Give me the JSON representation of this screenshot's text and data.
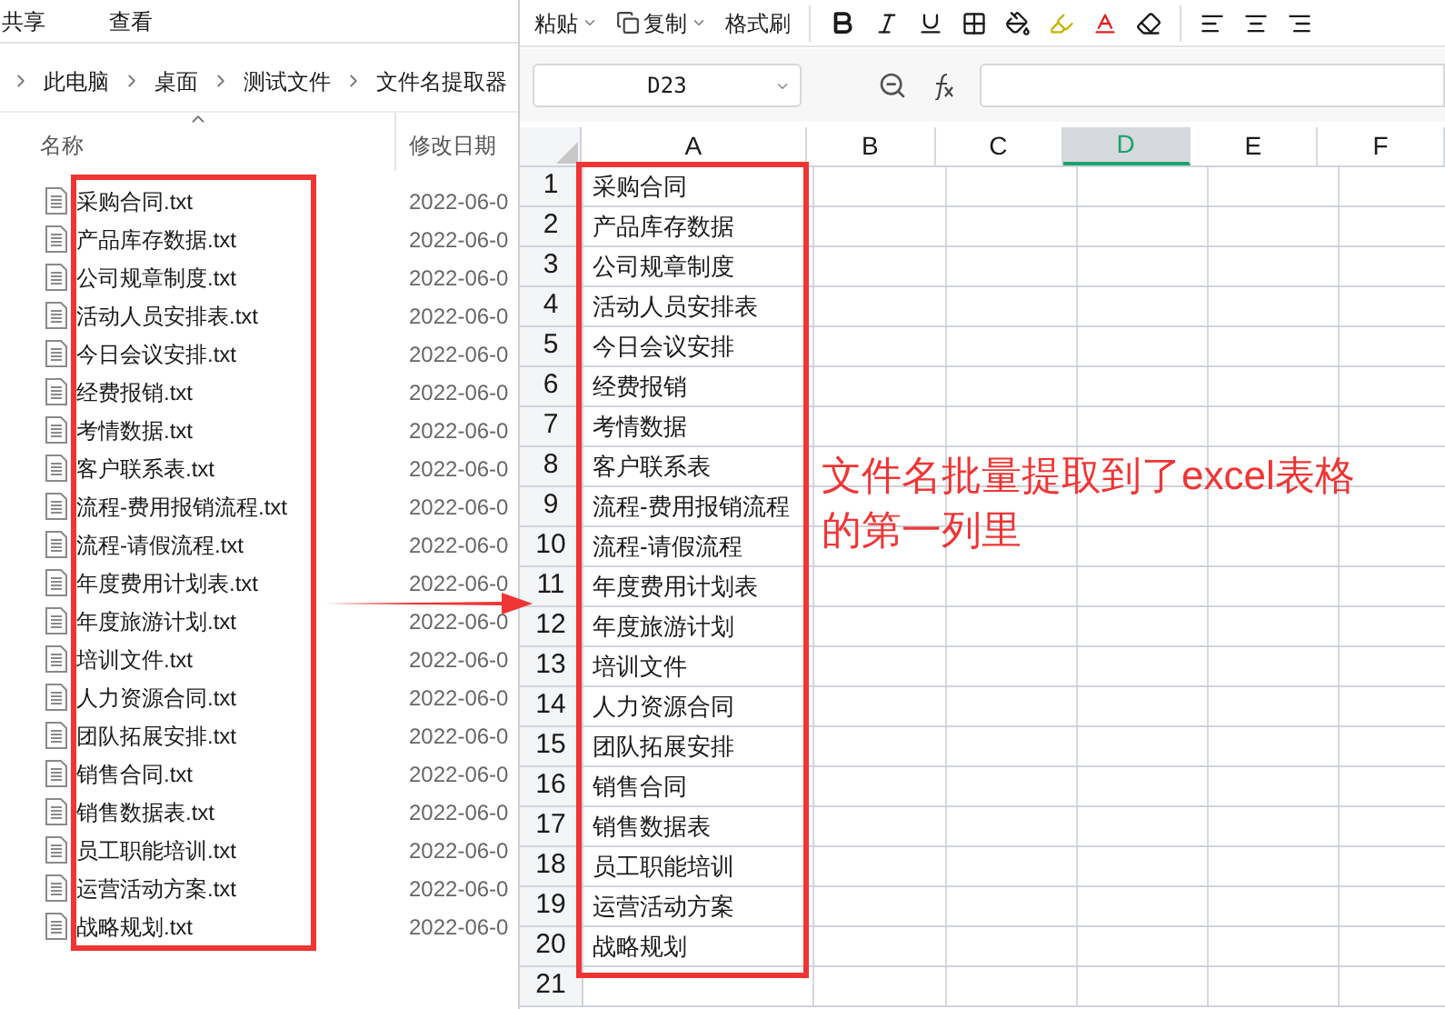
{
  "explorer": {
    "ribbon_tabs": [
      "共享",
      "查看"
    ],
    "breadcrumb": [
      "此电脑",
      "桌面",
      "测试文件",
      "文件名提取器"
    ],
    "columns": [
      {
        "label": "名称",
        "sorted": true
      },
      {
        "label": "修改日期",
        "sorted": false
      }
    ],
    "files": [
      {
        "name": "采购合同.txt",
        "date": "2022-06-0"
      },
      {
        "name": "产品库存数据.txt",
        "date": "2022-06-0"
      },
      {
        "name": "公司规章制度.txt",
        "date": "2022-06-0"
      },
      {
        "name": "活动人员安排表.txt",
        "date": "2022-06-0"
      },
      {
        "name": "今日会议安排.txt",
        "date": "2022-06-0"
      },
      {
        "name": "经费报销.txt",
        "date": "2022-06-0"
      },
      {
        "name": "考情数据.txt",
        "date": "2022-06-0"
      },
      {
        "name": "客户联系表.txt",
        "date": "2022-06-0"
      },
      {
        "name": "流程-费用报销流程.txt",
        "date": "2022-06-0"
      },
      {
        "name": "流程-请假流程.txt",
        "date": "2022-06-0"
      },
      {
        "name": "年度费用计划表.txt",
        "date": "2022-06-0"
      },
      {
        "name": "年度旅游计划.txt",
        "date": "2022-06-0"
      },
      {
        "name": "培训文件.txt",
        "date": "2022-06-0"
      },
      {
        "name": "人力资源合同.txt",
        "date": "2022-06-0"
      },
      {
        "name": "团队拓展安排.txt",
        "date": "2022-06-0"
      },
      {
        "name": "销售合同.txt",
        "date": "2022-06-0"
      },
      {
        "name": "销售数据表.txt",
        "date": "2022-06-0"
      },
      {
        "name": "员工职能培训.txt",
        "date": "2022-06-0"
      },
      {
        "name": "运营活动方案.txt",
        "date": "2022-06-0"
      },
      {
        "name": "战略规划.txt",
        "date": "2022-06-0"
      }
    ]
  },
  "spreadsheet": {
    "toolbar": [
      {
        "label": "粘贴"
      },
      {
        "label": "复制"
      },
      {
        "label": "格式刷"
      }
    ],
    "name_box": "D23",
    "columns": [
      {
        "label": "A",
        "selected": false
      },
      {
        "label": "B",
        "selected": false
      },
      {
        "label": "C",
        "selected": false
      },
      {
        "label": "D",
        "selected": true
      },
      {
        "label": "E",
        "selected": false
      },
      {
        "label": "F",
        "selected": false
      }
    ],
    "rows": [
      {
        "number": "1",
        "value": "采购合同"
      },
      {
        "number": "2",
        "value": "产品库存数据"
      },
      {
        "number": "3",
        "value": "公司规章制度"
      },
      {
        "number": "4",
        "value": "活动人员安排表"
      },
      {
        "number": "5",
        "value": "今日会议安排"
      },
      {
        "number": "6",
        "value": "经费报销"
      },
      {
        "number": "7",
        "value": "考情数据"
      },
      {
        "number": "8",
        "value": "客户联系表"
      },
      {
        "number": "9",
        "value": "流程-费用报销流程"
      },
      {
        "number": "10",
        "value": "流程-请假流程"
      },
      {
        "number": "11",
        "value": "年度费用计划表"
      },
      {
        "number": "12",
        "value": "年度旅游计划"
      },
      {
        "number": "13",
        "value": "培训文件"
      },
      {
        "number": "14",
        "value": "人力资源合同"
      },
      {
        "number": "15",
        "value": "团队拓展安排"
      },
      {
        "number": "16",
        "value": "销售合同"
      },
      {
        "number": "17",
        "value": "销售数据表"
      },
      {
        "number": "18",
        "value": "员工职能培训"
      },
      {
        "number": "19",
        "value": "运营活动方案"
      },
      {
        "number": "20",
        "value": "战略规划"
      },
      {
        "number": "21"
      }
    ]
  },
  "annotation": {
    "lines": [
      "文件名批量提取到了excel表格",
      "的第一列里"
    ]
  }
}
